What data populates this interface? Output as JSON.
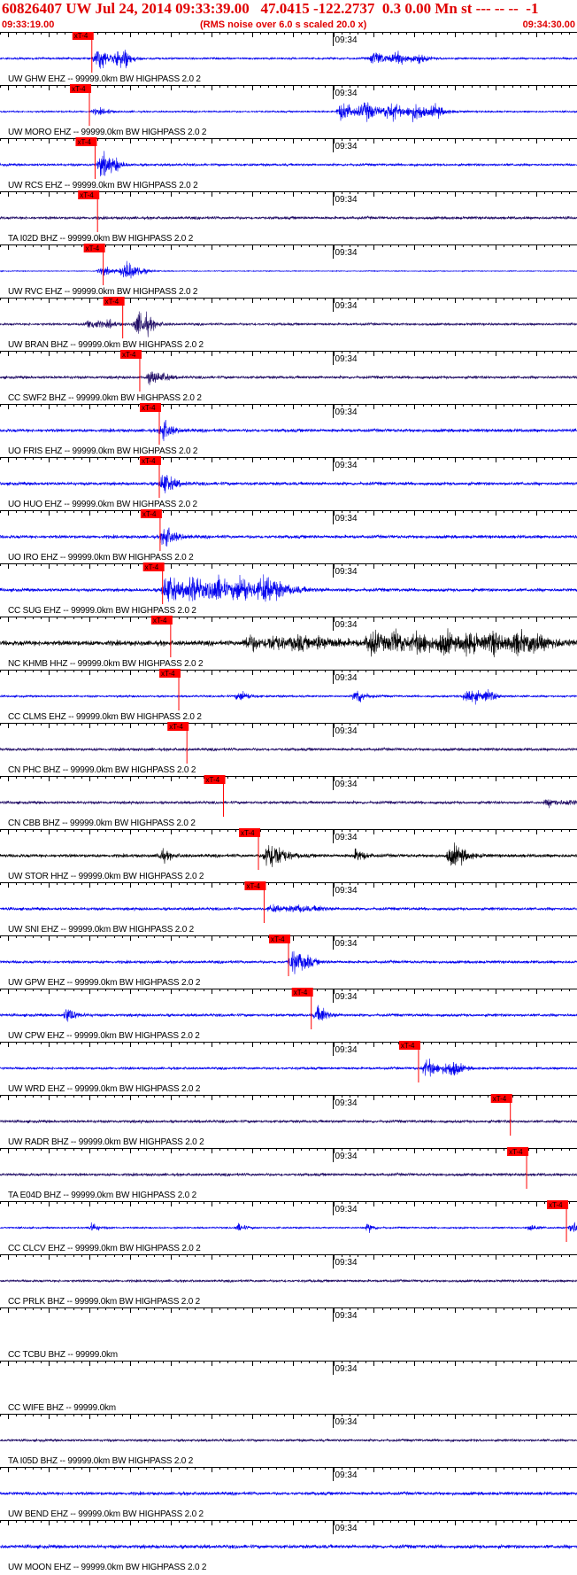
{
  "header": {
    "title": "60826407 UW Jul 24, 2014 09:33:39.00   47.0415 -122.2737  0.3 0.00 Mn st --- -- --  -1",
    "start_time": "09:33:19.00",
    "noise_note": "(RMS noise over 6.0 s scaled 20.0 x)",
    "end_time": "09:34:30.00"
  },
  "chart_data": {
    "type": "line",
    "title": "60826407 UW Jul 24, 2014 09:33:39.00   47.0415 -122.2737  0.3 0.00 Mn st --- -- --  -1",
    "xlabel": "",
    "ylabel": "",
    "x_range": [
      "09:33:19.00",
      "09:34:30.00"
    ],
    "minute_tick_label": "09:34",
    "pick_label": "xT-4",
    "colors": {
      "blue": "#0000ee",
      "navy": "#1e0a64",
      "black": "#000000",
      "pick": "#ff0000",
      "title": "#e00000"
    },
    "series": [
      {
        "name": "UW GHW EHZ -- 99999.0km BW  HIGHPASS  2.0  2",
        "color": "blue",
        "noise": 0.25,
        "pick_sec": 11.3,
        "events": [
          [
            11.5,
            2.2,
            4,
            6
          ],
          [
            45.5,
            1.4,
            6,
            5
          ]
        ]
      },
      {
        "name": "UW MORO EHZ -- 99999.0km BW  HIGHPASS  2.0  2",
        "color": "blue",
        "noise": 0.2,
        "pick_sec": 11.0,
        "events": [
          [
            11.3,
            0.6,
            2,
            8
          ],
          [
            41.5,
            2.0,
            12,
            4
          ]
        ]
      },
      {
        "name": "UW RCS EHZ -- 99999.0km BW  HIGHPASS  2.0  2",
        "color": "blue",
        "noise": 0.3,
        "pick_sec": 11.7,
        "events": [
          [
            12.0,
            2.4,
            2,
            6
          ]
        ]
      },
      {
        "name": "TA I02D BHZ -- 99999.0km BW  HIGHPASS  2.0  2",
        "color": "navy",
        "noise": 0.35,
        "pick_sec": 12.0,
        "events": []
      },
      {
        "name": "UW RVC EHZ -- 99999.0km BW  HIGHPASS  2.0  2",
        "color": "blue",
        "noise": 0.1,
        "pick_sec": 12.7,
        "events": [
          [
            12.0,
            0.9,
            4,
            5
          ],
          [
            15.0,
            1.4,
            2,
            5
          ]
        ]
      },
      {
        "name": "UW BRAN BHZ -- 99999.0km BW  HIGHPASS  2.0  2",
        "color": "navy",
        "noise": 0.3,
        "pick_sec": 15.1,
        "events": [
          [
            10.5,
            1.0,
            3,
            6
          ],
          [
            16.5,
            2.6,
            1.5,
            5
          ]
        ]
      },
      {
        "name": "CC SWF2 BHZ -- 99999.0km BW  HIGHPASS  2.0  2",
        "color": "navy",
        "noise": 0.35,
        "pick_sec": 17.2,
        "events": [
          [
            18.0,
            1.2,
            2,
            6
          ]
        ]
      },
      {
        "name": "UO FRIS EHZ -- 99999.0km BW  HIGHPASS  2.0  2",
        "color": "blue",
        "noise": 0.4,
        "pick_sec": 19.6,
        "events": [
          [
            19.7,
            2.6,
            0.5,
            5
          ]
        ]
      },
      {
        "name": "UO HUO EHZ -- 99999.0km BW  HIGHPASS  2.0  2",
        "color": "blue",
        "noise": 0.4,
        "pick_sec": 19.6,
        "events": [
          [
            19.7,
            2.6,
            0.6,
            4
          ]
        ]
      },
      {
        "name": "UO IRO EHZ -- 99999.0km BW  HIGHPASS  2.0  2",
        "color": "blue",
        "noise": 0.4,
        "pick_sec": 19.7,
        "events": [
          [
            19.8,
            2.6,
            0.6,
            4
          ]
        ]
      },
      {
        "name": "CC SUG EHZ -- 99999.0km BW  HIGHPASS  2.0  2",
        "color": "blue",
        "noise": 0.4,
        "pick_sec": 20.0,
        "events": [
          [
            20.0,
            3.2,
            13,
            2
          ]
        ]
      },
      {
        "name": "NC KHMB HHZ -- 99999.0km BW  HIGHPASS  2.0  2",
        "color": "black",
        "noise": 0.6,
        "pick_sec": 21.0,
        "events": [
          [
            30.0,
            1.6,
            9,
            1.5
          ],
          [
            45.0,
            2.5,
            20,
            1.5
          ]
        ]
      },
      {
        "name": "CC CLMS EHZ -- 99999.0km BW  HIGHPASS  2.0  2",
        "color": "blue",
        "noise": 0.25,
        "pick_sec": 22.0,
        "events": [
          [
            29.0,
            1.0,
            1,
            5
          ],
          [
            43.5,
            2.0,
            0.5,
            5
          ],
          [
            57.0,
            1.8,
            3,
            5
          ]
        ]
      },
      {
        "name": "CN PHC BHZ -- 99999.0km BW  HIGHPASS  2.0  2",
        "color": "navy",
        "noise": 0.35,
        "pick_sec": 23.0,
        "events": []
      },
      {
        "name": "CN CBB BHZ -- 99999.0km BW  HIGHPASS  2.0  2",
        "color": "navy",
        "noise": 0.35,
        "pick_sec": 27.5,
        "events": [
          [
            67.0,
            0.7,
            3,
            5
          ]
        ]
      },
      {
        "name": "UW STOR HHZ -- 99999.0km BW  HIGHPASS  2.0  2",
        "color": "black",
        "noise": 0.4,
        "pick_sec": 31.8,
        "events": [
          [
            19.5,
            1.4,
            0.5,
            5
          ],
          [
            32.5,
            3.0,
            1.5,
            4
          ],
          [
            43.5,
            1.4,
            0.5,
            5
          ],
          [
            55.0,
            2.2,
            1.5,
            4
          ]
        ]
      },
      {
        "name": "UW SNI EHZ -- 99999.0km BW  HIGHPASS  2.0  2",
        "color": "blue",
        "noise": 0.35,
        "pick_sec": 32.5,
        "events": [
          [
            33.0,
            0.7,
            6,
            4
          ]
        ]
      },
      {
        "name": "UW GPW EHZ -- 99999.0km BW  HIGHPASS  2.0  2",
        "color": "blue",
        "noise": 0.35,
        "pick_sec": 35.5,
        "events": [
          [
            35.5,
            2.4,
            2,
            5
          ]
        ]
      },
      {
        "name": "UW CPW EHZ -- 99999.0km BW  HIGHPASS  2.0  2",
        "color": "blue",
        "noise": 0.35,
        "pick_sec": 38.3,
        "events": [
          [
            8.0,
            2.4,
            0.2,
            5
          ],
          [
            38.7,
            1.8,
            1,
            6
          ]
        ]
      },
      {
        "name": "UW WRD EHZ -- 99999.0km BW  HIGHPASS  2.0  2",
        "color": "blue",
        "noise": 0.3,
        "pick_sec": 51.5,
        "events": [
          [
            52.0,
            1.8,
            4,
            5
          ]
        ]
      },
      {
        "name": "UW RADR BHZ -- 99999.0km BW  HIGHPASS  2.0  2",
        "color": "navy",
        "noise": 0.35,
        "pick_sec": 62.8,
        "events": []
      },
      {
        "name": "TA E04D BHZ -- 99999.0km BW  HIGHPASS  2.0  2",
        "color": "navy",
        "noise": 0.35,
        "pick_sec": 64.8,
        "events": []
      },
      {
        "name": "CC CLCV EHZ -- 99999.0km BW  HIGHPASS  2.0  2",
        "color": "blue",
        "noise": 0.2,
        "pick_sec": 69.7,
        "events": [
          [
            11.0,
            1.2,
            0.4,
            6
          ],
          [
            29.0,
            1.0,
            0.4,
            6
          ],
          [
            45.0,
            1.0,
            0.4,
            6
          ],
          [
            65.0,
            1.0,
            0.4,
            6
          ],
          [
            70.0,
            1.6,
            0.5,
            6
          ]
        ]
      },
      {
        "name": "CC PRLK BHZ -- 99999.0km BW  HIGHPASS  2.0  2",
        "color": "navy",
        "noise": 0.3,
        "pick_sec": null,
        "events": []
      },
      {
        "name": "CC TCBU BHZ -- 99999.0km",
        "color": "none",
        "noise": 0,
        "pick_sec": null,
        "events": []
      },
      {
        "name": "CC WIFE BHZ -- 99999.0km",
        "color": "none",
        "noise": 0,
        "pick_sec": null,
        "events": []
      },
      {
        "name": "TA I05D BHZ -- 99999.0km BW  HIGHPASS  2.0  2",
        "color": "navy",
        "noise": 0.3,
        "pick_sec": null,
        "events": []
      },
      {
        "name": "UW BEND EHZ -- 99999.0km BW  HIGHPASS  2.0  2",
        "color": "blue",
        "noise": 0.4,
        "pick_sec": null,
        "events": []
      },
      {
        "name": "UW MOON EHZ -- 99999.0km BW  HIGHPASS  2.0  2",
        "color": "blue",
        "noise": 0.45,
        "pick_sec": null,
        "events": []
      }
    ]
  }
}
